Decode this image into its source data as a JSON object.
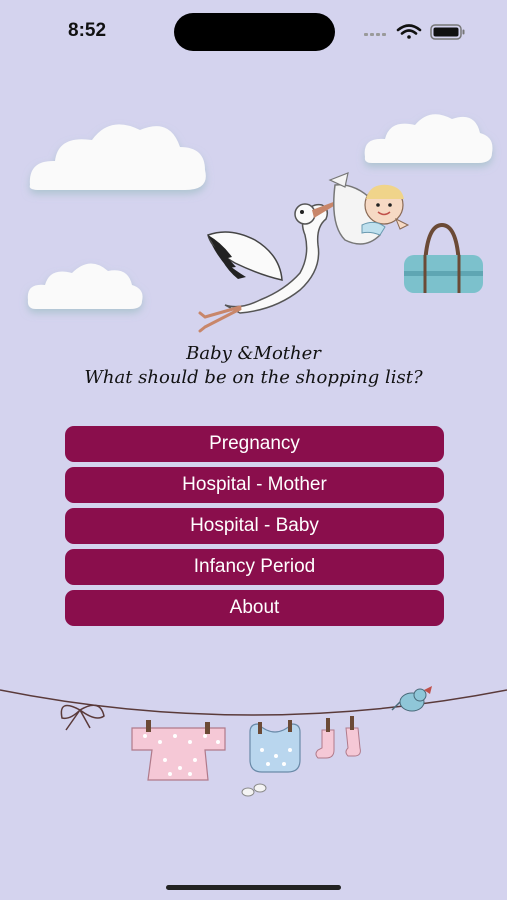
{
  "status_bar": {
    "time": "8:52",
    "icons": [
      "signal-icon",
      "wifi-icon",
      "battery-icon"
    ]
  },
  "header": {
    "title": "Baby &Mother",
    "subtitle": "What should be on the shopping list?"
  },
  "menu": {
    "items": [
      {
        "label": "Pregnancy"
      },
      {
        "label": "Hospital - Mother"
      },
      {
        "label": "Hospital - Baby"
      },
      {
        "label": "Infancy Period"
      },
      {
        "label": "About"
      }
    ]
  },
  "colors": {
    "background": "#d4d3ee",
    "button": "#8a0e4c",
    "button_text": "#ffffff"
  }
}
